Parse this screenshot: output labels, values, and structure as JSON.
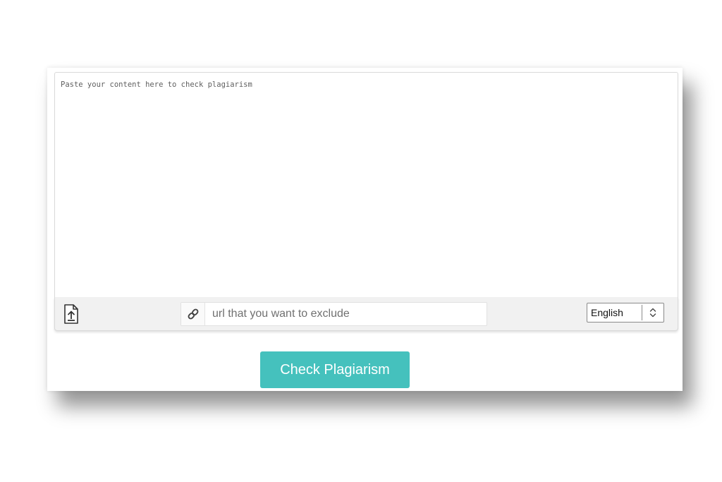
{
  "editor": {
    "placeholder": "Paste your content here to check plagiarism",
    "value": ""
  },
  "toolbar": {
    "upload_icon": "file-upload-icon",
    "link_icon": "link-icon",
    "url_input": {
      "placeholder": "url that you want to exclude",
      "value": ""
    },
    "language_select": {
      "selected": "English",
      "icon": "up-down-chevron-icon"
    }
  },
  "actions": {
    "check_label": "Check Plagiarism"
  },
  "colors": {
    "accent": "#45c1bd",
    "toolbar_bg": "#f1f1f1"
  }
}
